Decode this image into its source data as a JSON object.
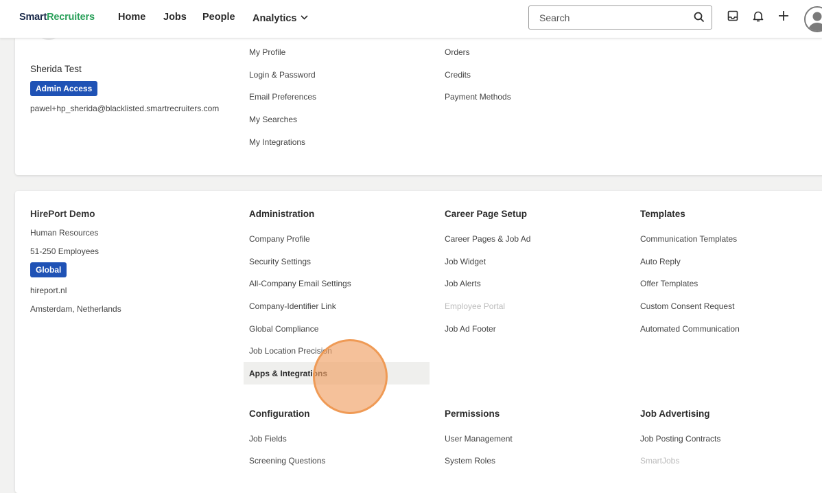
{
  "brand": {
    "part1": "Smart",
    "part2": "Recruiters"
  },
  "nav": {
    "home": "Home",
    "jobs": "Jobs",
    "people": "People",
    "analytics": "Analytics"
  },
  "search": {
    "placeholder": "Search"
  },
  "icons": [
    "search-icon",
    "inbox-icon",
    "bell-icon",
    "plus-icon",
    "user-avatar-icon",
    "chevron-down-icon"
  ],
  "colors": {
    "accent": "#1f52b5",
    "brand_green": "#2aa05a",
    "cursor": "#ef9a55"
  },
  "user": {
    "name": "Sherida Test",
    "badge": "Admin Access",
    "email": "pawel+hp_sherida@blacklisted.smartrecruiters.com"
  },
  "account_links": {
    "col1": [
      "My Profile",
      "Login & Password",
      "Email Preferences",
      "My Searches",
      "My Integrations"
    ],
    "col2": [
      "Orders",
      "Credits",
      "Payment Methods"
    ]
  },
  "company": {
    "name": "HirePort Demo",
    "department": "Human Resources",
    "size": "51-250 Employees",
    "badge": "Global",
    "website": "hireport.nl",
    "location": "Amsterdam, Netherlands"
  },
  "administration": {
    "title": "Administration",
    "items": [
      "Company Profile",
      "Security Settings",
      "All-Company Email Settings",
      "Company-Identifier Link",
      "Global Compliance",
      "Job Location Precision",
      "Apps & Integrations"
    ]
  },
  "career_page": {
    "title": "Career Page Setup",
    "items": [
      "Career Pages & Job Ad",
      "Job Widget",
      "Job Alerts",
      "Employee Portal",
      "Job Ad Footer"
    ]
  },
  "templates": {
    "title": "Templates",
    "items": [
      "Communication Templates",
      "Auto Reply",
      "Offer Templates",
      "Custom Consent Request",
      "Automated Communication"
    ]
  },
  "configuration": {
    "title": "Configuration",
    "items": [
      "Job Fields",
      "Screening Questions"
    ]
  },
  "permissions": {
    "title": "Permissions",
    "items": [
      "User Management",
      "System Roles"
    ]
  },
  "job_advertising": {
    "title": "Job Advertising",
    "items": [
      "Job Posting Contracts",
      "SmartJobs"
    ]
  }
}
